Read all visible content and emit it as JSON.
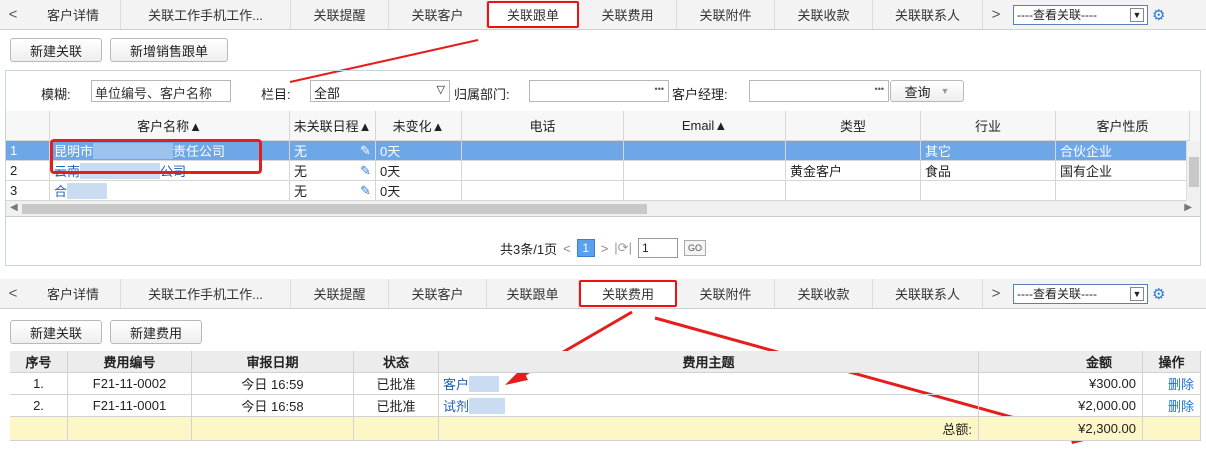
{
  "top_tabs": {
    "items": [
      "客户详情",
      "关联工作手机工作...",
      "关联提醒",
      "关联客户",
      "关联跟单",
      "关联费用",
      "关联附件",
      "关联收款",
      "关联联系人"
    ],
    "active_index": 4,
    "related_select": "----查看关联----"
  },
  "top_buttons": {
    "new_link": "新建关联",
    "new_followup": "新增销售跟单"
  },
  "filter": {
    "fuzzy_label": "模糊:",
    "fuzzy_placeholder": "单位编号、客户名称",
    "column_label": "栏目:",
    "column_value": "全部",
    "dept_label": "归属部门:",
    "manager_label": "客户经理:",
    "query_button": "查询"
  },
  "grid": {
    "headers": [
      "客户名称▲",
      "未关联日程▲",
      "未变化▲",
      "电话",
      "Email▲",
      "类型",
      "行业",
      "客户性质"
    ],
    "rows": [
      {
        "num": "1",
        "name_pre": "昆明市",
        "name_post": "责任公司",
        "schedule": "无",
        "unchanged": "0天",
        "phone": "",
        "email": "",
        "type": "",
        "industry": "其它",
        "nature": "合伙企业"
      },
      {
        "num": "2",
        "name_pre": "云南",
        "name_post": "公司",
        "schedule": "无",
        "unchanged": "0天",
        "phone": "",
        "email": "",
        "type": "黄金客户",
        "industry": "食品",
        "nature": "国有企业"
      },
      {
        "num": "3",
        "name_pre": "合",
        "name_post": "",
        "schedule": "无",
        "unchanged": "0天",
        "phone": "",
        "email": "",
        "type": "",
        "industry": "",
        "nature": ""
      }
    ],
    "pager_summary": "共3条/1页",
    "current_page": "1",
    "page_input": "1",
    "go": "GO"
  },
  "bottom_tabs": {
    "items": [
      "客户详情",
      "关联工作手机工作...",
      "关联提醒",
      "关联客户",
      "关联跟单",
      "关联费用",
      "关联附件",
      "关联收款",
      "关联联系人"
    ],
    "active_index": 5,
    "related_select": "----查看关联----"
  },
  "bottom_buttons": {
    "new_link": "新建关联",
    "new_expense": "新建费用"
  },
  "expense_table": {
    "headers": [
      "序号",
      "费用编号",
      "审报日期",
      "状态",
      "费用主题",
      "金额",
      "操作"
    ],
    "rows": [
      {
        "num": "1.",
        "code": "F21-11-0002",
        "date": "今日 16:59",
        "status": "已批准",
        "subject": "客户",
        "amount": "¥300.00",
        "action": "删除"
      },
      {
        "num": "2.",
        "code": "F21-11-0001",
        "date": "今日 16:58",
        "status": "已批准",
        "subject": "试剂",
        "amount": "¥2,000.00",
        "action": "删除"
      }
    ],
    "total_label": "总额:",
    "total_amount": "¥2,300.00"
  },
  "colors": {
    "highlight_red": "#e41d1d",
    "selected_row": "#6ea7e8",
    "total_row": "#fdf7c7"
  }
}
